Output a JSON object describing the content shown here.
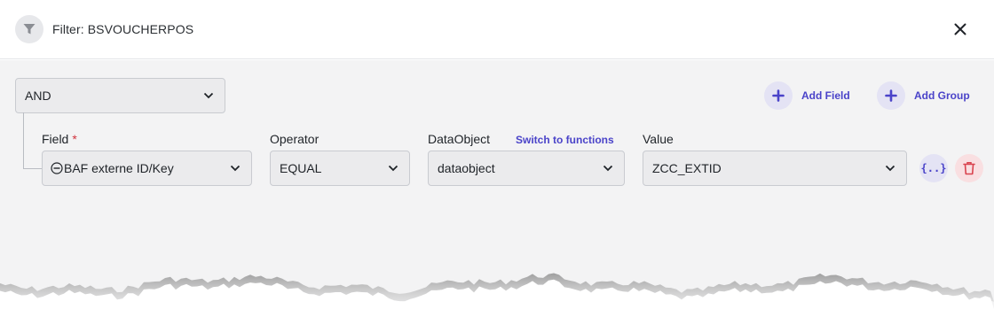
{
  "header": {
    "title": "Filter: BSVOUCHERPOS",
    "filter_icon": "filter-funnel-icon",
    "close_icon": "close-x-icon"
  },
  "group": {
    "logic_value": "AND",
    "add_field_label": "Add Field",
    "add_group_label": "Add Group"
  },
  "condition": {
    "field_label": "Field",
    "field_required_marker": "*",
    "field_value": "BAF externe ID/Key",
    "operator_label": "Operator",
    "operator_value": "EQUAL",
    "dataobject_label": "DataObject",
    "switch_link": "Switch to functions",
    "dataobject_value": "dataobject",
    "value_label": "Value",
    "value_value": "ZCC_EXTID",
    "variable_button_text": "{..}"
  },
  "colors": {
    "accent": "#4a43c9",
    "danger": "#d9434e",
    "required": "#d0343f",
    "panel_bg": "#f3f3f4"
  }
}
